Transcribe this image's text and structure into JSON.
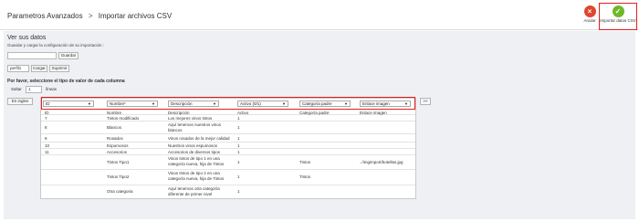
{
  "header": {
    "breadcrumb_root": "Parametros Avanzados",
    "breadcrumb_separator": ">",
    "breadcrumb_current": "Importar archivos CSV",
    "cancel_label": "Anular",
    "import_label": "Importar datos CSV"
  },
  "save": {
    "title": "Ver sus datos",
    "description": "Guardar y cargar la configuración de su importación :",
    "input_value": "",
    "save_button": "Guardar",
    "profile_selected": "perfil1",
    "load_button": "Cargar",
    "delete_button": "Suprimir"
  },
  "mapping": {
    "title": "Por favor, seleccione el tipo de valor de cada columna",
    "skip_label": "Saltar",
    "skip_value": "1",
    "skip_unit": "líneas",
    "prev_button": "En ingles",
    "next_button": ">>",
    "column_selects": [
      "ID",
      "Nombre*",
      "Descripción",
      "Activo (0/1)",
      "Categoría padre",
      "Enlace imagen"
    ]
  },
  "rows": [
    [
      "ID",
      "Nombre",
      "Descripción",
      "Activo",
      "Categoría padre",
      "Enlace imagen"
    ],
    [
      "7",
      "Tintos modificado",
      "Los mejores vinos tintos",
      "1",
      "",
      ""
    ],
    [
      "8",
      "Blancos",
      "Aquí tenemos nuestros vinos blancos",
      "1",
      "",
      ""
    ],
    [
      "9",
      "Rosados",
      "Vinos rosados de la mejor calidad",
      "1",
      "",
      ""
    ],
    [
      "10",
      "Espumosos",
      "Nuestros vinos espumosos",
      "1",
      "",
      ""
    ],
    [
      "11",
      "Accesorios",
      "Accesorios de diversos tipos",
      "1",
      "",
      ""
    ],
    [
      "",
      "Tintos Tipo1",
      "Vinos tintos de tipo 1 en una categoría nueva, hija de Tintos",
      "1",
      "Tintos",
      "../imgimport/botellas.jpg"
    ],
    [
      "",
      "Tintos Tipo2",
      "Vinos tintos de tipo 2 en una categoría nueva, hija de Tintos",
      "1",
      "Tintos",
      ""
    ],
    [
      "",
      "Otra categoria",
      "Aquí tenemos otra categoría diferente de primer nivel",
      "1",
      "",
      ""
    ]
  ],
  "colors": {
    "highlight": "#e41e1e",
    "cancel_icon": "#e0462f",
    "import_icon": "#6db829",
    "panel_bg": "#eef0f4"
  },
  "icons": {
    "cancel": "cancel-icon",
    "import": "checkmark-icon"
  }
}
